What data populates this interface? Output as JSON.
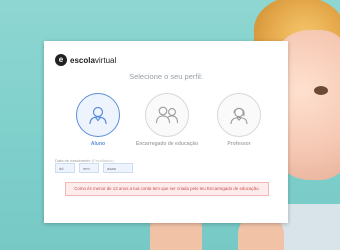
{
  "brand": {
    "logo_letter": "e",
    "name_bold": "escola",
    "name_rest": "virtual"
  },
  "title": "Selecione o seu perfil:",
  "profiles": [
    {
      "label": "Aluno",
      "icon": "student-icon",
      "selected": true
    },
    {
      "label": "Encarregado de educação",
      "icon": "guardian-icon",
      "selected": false
    },
    {
      "label": "Professor",
      "icon": "teacher-icon",
      "selected": false
    }
  ],
  "dob": {
    "label": "Data de nascimento",
    "optional": "(Facultativo)",
    "day_placeholder": "dd",
    "month_placeholder": "mm",
    "year_placeholder": "aaaa"
  },
  "warning": "Como és menor de 13 anos a tua conta tem que ser criada pelo teu Encarregado de educação.",
  "colors": {
    "accent": "#5b8fd9",
    "warning_text": "#d24b4b",
    "warning_bg": "#fdecec"
  }
}
